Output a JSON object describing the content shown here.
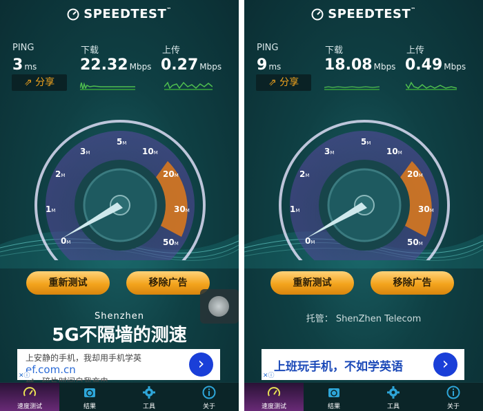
{
  "left": {
    "app_name": "SPEEDTEST",
    "trademark": "™",
    "ping": {
      "label": "PING",
      "value": "3",
      "unit": "ms"
    },
    "download": {
      "label": "下载",
      "value": "22.32",
      "unit": "Mbps"
    },
    "upload": {
      "label": "上传",
      "value": "0.27",
      "unit": "Mbps"
    },
    "share_label": "分享",
    "gauge_ticks": [
      "0",
      "1",
      "2",
      "3",
      "5",
      "10",
      "20",
      "30",
      "50"
    ],
    "gauge_unit": "M",
    "retest_label": "重新测试",
    "remove_ads_label": "移除广告",
    "location": "Shenzhen",
    "promo_headline": "5G不隔墙的测速",
    "ad": {
      "line1": "上安静的手机，我却用手机学英",
      "url": "ef.com.cn",
      "line3": "钟，碎片时间自我充电"
    },
    "tabs": [
      {
        "label": "速度测试",
        "icon": "gauge-icon"
      },
      {
        "label": "结果",
        "icon": "results-icon"
      },
      {
        "label": "工具",
        "icon": "gear-icon"
      },
      {
        "label": "关于",
        "icon": "info-icon"
      }
    ]
  },
  "right": {
    "app_name": "SPEEDTEST",
    "trademark": "™",
    "ping": {
      "label": "PING",
      "value": "9",
      "unit": "ms"
    },
    "download": {
      "label": "下载",
      "value": "18.08",
      "unit": "Mbps"
    },
    "upload": {
      "label": "上传",
      "value": "0.49",
      "unit": "Mbps"
    },
    "share_label": "分享",
    "gauge_ticks": [
      "0",
      "1",
      "2",
      "3",
      "5",
      "10",
      "20",
      "30",
      "50"
    ],
    "gauge_unit": "M",
    "retest_label": "重新测试",
    "remove_ads_label": "移除广告",
    "host_info": "托管： ShenZhen Telecom",
    "ad": {
      "headline": "上班玩手机，不如学英语"
    },
    "tabs": [
      {
        "label": "速度测试",
        "icon": "gauge-icon"
      },
      {
        "label": "结果",
        "icon": "results-icon"
      },
      {
        "label": "工具",
        "icon": "gear-icon"
      },
      {
        "label": "关于",
        "icon": "info-icon"
      }
    ]
  },
  "colors": {
    "accent": "#f3a41d",
    "background": "#0f4044",
    "ad_button": "#1a3fd8"
  }
}
